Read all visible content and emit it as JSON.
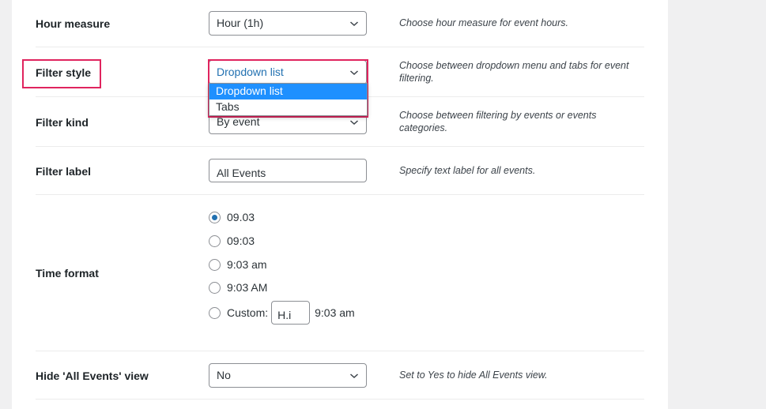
{
  "colors": {
    "highlight": "#e0245e",
    "selected_option_bg": "#1e90ff",
    "radio_checked": "#2271b1"
  },
  "settings": {
    "hour_measure": {
      "label": "Hour measure",
      "value": "Hour (1h)",
      "description": "Choose hour measure for event hours."
    },
    "filter_style": {
      "label": "Filter style",
      "value": "Dropdown list",
      "description": "Choose between dropdown menu and tabs for event filtering.",
      "options": [
        "Dropdown list",
        "Tabs"
      ],
      "selected_option": "Dropdown list"
    },
    "filter_kind": {
      "label": "Filter kind",
      "value": "By event",
      "description": "Choose between filtering by events or events categories."
    },
    "filter_label": {
      "label": "Filter label",
      "value": "All Events",
      "description": "Specify text label for all events."
    },
    "time_format": {
      "label": "Time format",
      "options": [
        {
          "label": "09.03",
          "checked": true
        },
        {
          "label": "09:03",
          "checked": false
        },
        {
          "label": "9:03 am",
          "checked": false
        },
        {
          "label": "9:03 AM",
          "checked": false
        }
      ],
      "custom": {
        "label": "Custom:",
        "value": "H.i",
        "preview": "9:03 am",
        "checked": false
      }
    },
    "hide_all_events": {
      "label": "Hide 'All Events' view",
      "value": "No",
      "description": "Set to Yes to hide All Events view."
    }
  }
}
